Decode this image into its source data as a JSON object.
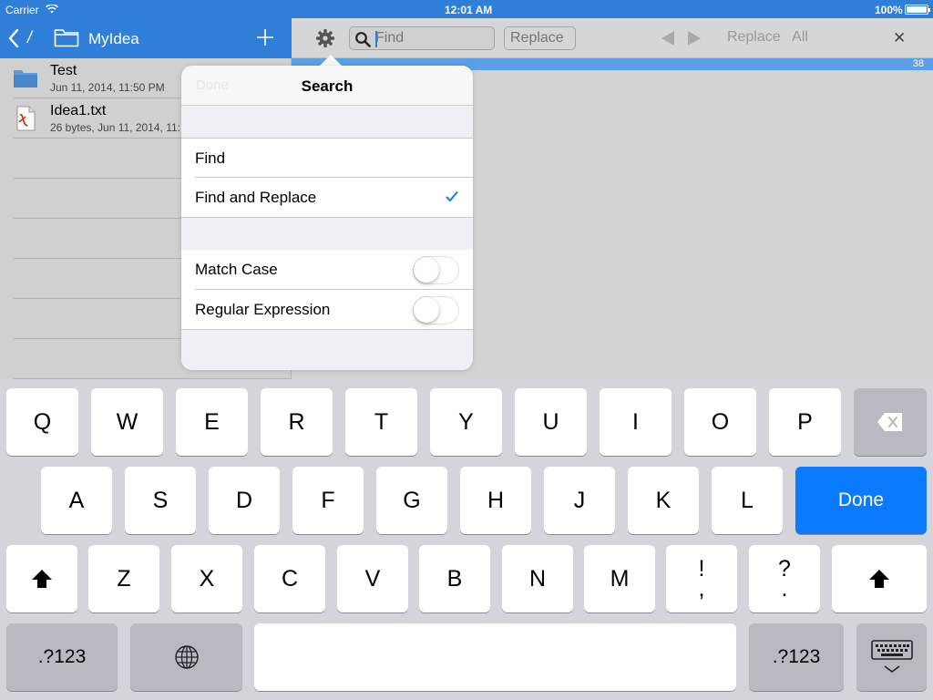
{
  "status_bar": {
    "carrier": "Carrier",
    "time": "12:01 AM",
    "battery": "100%"
  },
  "nav": {
    "path_separator": "/",
    "title": "MyIdea"
  },
  "files": [
    {
      "name": "Test",
      "meta": "Jun 11, 2014, 11:50 PM",
      "type": "folder"
    },
    {
      "name": "Idea1.txt",
      "meta": "26 bytes, Jun 11, 2014, 11:",
      "type": "text-file"
    }
  ],
  "toolbar": {
    "find_placeholder": "Find",
    "replace_placeholder": "Replace",
    "replace_all_label": "Replace   All",
    "close_label": "✕"
  },
  "editor": {
    "line_count": "38"
  },
  "popover": {
    "done_label": "Done",
    "title": "Search",
    "mode_options": [
      {
        "label": "Find",
        "selected": false
      },
      {
        "label": "Find and Replace",
        "selected": true
      }
    ],
    "toggles": [
      {
        "label": "Match Case",
        "on": false
      },
      {
        "label": "Regular Expression",
        "on": false
      }
    ],
    "accent_color": "#0a7bff"
  },
  "keyboard": {
    "row1": [
      "Q",
      "W",
      "E",
      "R",
      "T",
      "Y",
      "U",
      "I",
      "O",
      "P"
    ],
    "row2": [
      "A",
      "S",
      "D",
      "F",
      "G",
      "H",
      "J",
      "K",
      "L"
    ],
    "row3": [
      "Z",
      "X",
      "C",
      "V",
      "B",
      "N",
      "M"
    ],
    "punct1_top": "!",
    "punct1_bottom": ",",
    "punct2_top": "?",
    "punct2_bottom": ".",
    "done_label": "Done",
    "numbers_label": ".?123",
    "done_color": "#0a7bff"
  }
}
